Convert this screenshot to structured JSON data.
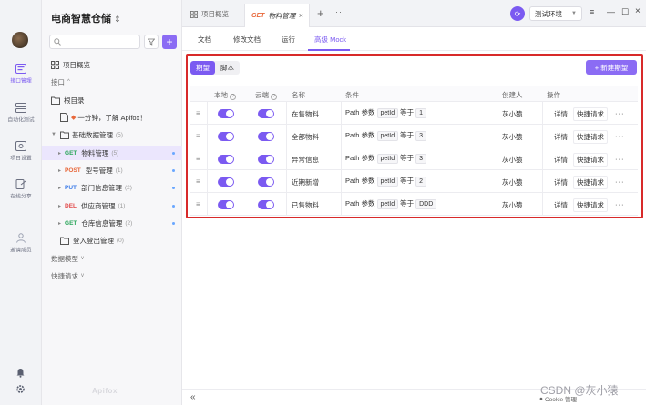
{
  "sidebar": {
    "items": [
      {
        "label": "接口管理",
        "icon": "api-icon"
      },
      {
        "label": "自动化测试",
        "icon": "automation-icon"
      },
      {
        "label": "项目设置",
        "icon": "settings-icon"
      },
      {
        "label": "在线分享",
        "icon": "share-icon"
      },
      {
        "label": "邀请成员",
        "icon": "invite-icon"
      }
    ]
  },
  "tree": {
    "project_title": "电商智慧仓储",
    "overview": "项目概览",
    "api_section": "接口",
    "root_dir": "根目录",
    "intro": "一分钟，了解 Apifox！",
    "folder": {
      "name": "基础数据管理",
      "count": "(5)"
    },
    "apis": [
      {
        "method": "GET",
        "name": "物料管理",
        "count": "(5)",
        "color": "#2aa55a"
      },
      {
        "method": "POST",
        "name": "型号管理",
        "count": "(1)",
        "color": "#e8683b"
      },
      {
        "method": "PUT",
        "name": "部门信息管理",
        "count": "(2)",
        "color": "#3a7ae8"
      },
      {
        "method": "DEL",
        "name": "供应商管理",
        "count": "(1)",
        "color": "#e24a4a"
      },
      {
        "method": "GET",
        "name": "仓库信息管理",
        "count": "(2)",
        "color": "#2aa55a"
      }
    ],
    "folder2": {
      "name": "登入登出管理",
      "count": "(0)"
    },
    "data_model": "数据模型",
    "quick_request": "快捷请求",
    "brand": "Apifox"
  },
  "topbar": {
    "tab_overview": "项目概览",
    "active_tab": {
      "method": "GET",
      "name": "物料管理"
    },
    "env": "测试环境"
  },
  "subtabs": [
    "文档",
    "修改文档",
    "运行",
    "高级 Mock"
  ],
  "mock": {
    "seg_expect": "期望",
    "seg_script": "脚本",
    "new_button": "+ 新建期望",
    "columns": {
      "local": "本地",
      "cloud": "云端",
      "name": "名称",
      "condition": "条件",
      "creator": "创建人",
      "actions": "操作"
    },
    "rows": [
      {
        "name": "在售物料",
        "cond_type": "Path 参数",
        "cond_param": "petId",
        "cond_op": "等于",
        "cond_value": "1",
        "creator": "灰小猿"
      },
      {
        "name": "全部物料",
        "cond_type": "Path 参数",
        "cond_param": "petId",
        "cond_op": "等于",
        "cond_value": "3",
        "creator": "灰小猿"
      },
      {
        "name": "异常信息",
        "cond_type": "Path 参数",
        "cond_param": "petId",
        "cond_op": "等于",
        "cond_value": "3",
        "creator": "灰小猿"
      },
      {
        "name": "近期新增",
        "cond_type": "Path 参数",
        "cond_param": "petId",
        "cond_op": "等于",
        "cond_value": "2",
        "creator": "灰小猿"
      },
      {
        "name": "已售物料",
        "cond_type": "Path 参数",
        "cond_param": "petId",
        "cond_op": "等于",
        "cond_value": "DDD",
        "creator": "灰小猿"
      }
    ],
    "action_detail": "详情",
    "action_quick": "快捷请求"
  },
  "bottom": {
    "cookie": "Cookie 管理",
    "watermark": "CSDN @灰小猿"
  },
  "colors": {
    "accent": "#7b5af1",
    "highlight_frame": "#d82a2a"
  }
}
